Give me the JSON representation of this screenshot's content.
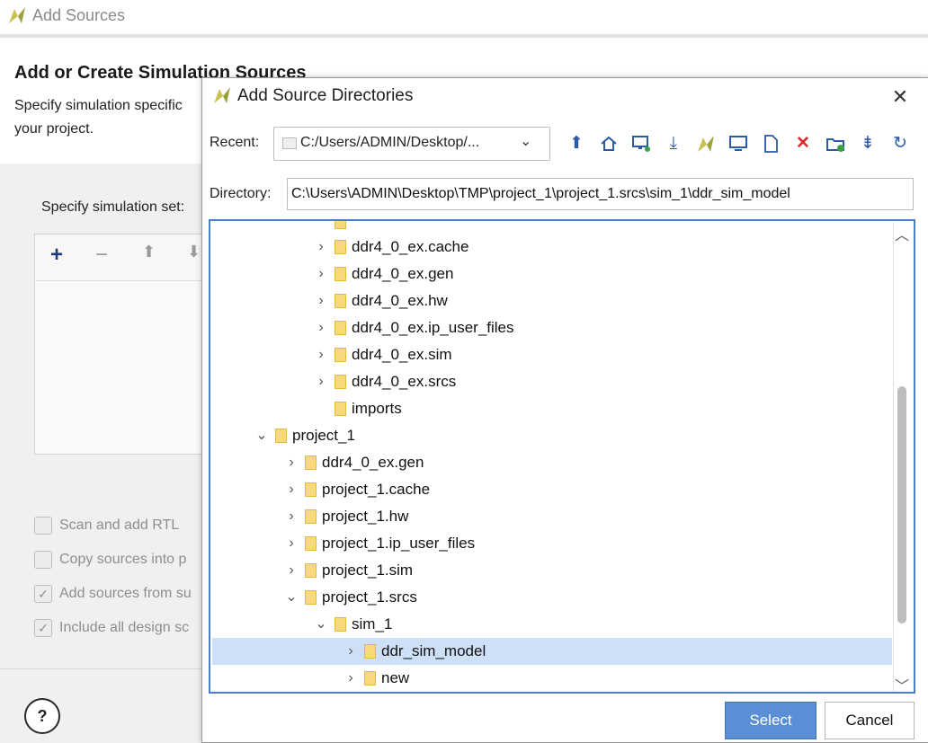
{
  "background": {
    "window_title": "Add Sources",
    "heading": "Add or Create Simulation Sources",
    "description_line1": "Specify simulation specific",
    "description_line2": "your project.",
    "simulation_set_label": "Specify simulation set:",
    "options": [
      {
        "label": "Scan and add RTL",
        "checked": false
      },
      {
        "label": "Copy sources into p",
        "checked": false
      },
      {
        "label": "Add sources from su",
        "checked": true
      },
      {
        "label": "Include all design sc",
        "checked": true
      }
    ],
    "help_label": "?"
  },
  "dialog": {
    "title": "Add Source Directories",
    "close_label": "✕",
    "recent_label": "Recent:",
    "recent_value": "C:/Users/ADMIN/Desktop/...",
    "directory_label": "Directory:",
    "directory_value": "C:\\Users\\ADMIN\\Desktop\\TMP\\project_1\\project_1.srcs\\sim_1\\ddr_sim_model",
    "toolbar_icons": [
      "up-folder-icon",
      "home-icon",
      "network-icon",
      "download-icon",
      "vivado-icon",
      "desktop-icon",
      "file-icon",
      "delete-icon",
      "new-folder-icon",
      "collapse-icon",
      "refresh-icon"
    ],
    "tree": [
      {
        "label": "ddr4_0_ex.cache",
        "depth": 4,
        "expanded": false,
        "has_children": true
      },
      {
        "label": "ddr4_0_ex.gen",
        "depth": 4,
        "expanded": false,
        "has_children": true
      },
      {
        "label": "ddr4_0_ex.hw",
        "depth": 4,
        "expanded": false,
        "has_children": true
      },
      {
        "label": "ddr4_0_ex.ip_user_files",
        "depth": 4,
        "expanded": false,
        "has_children": true
      },
      {
        "label": "ddr4_0_ex.sim",
        "depth": 4,
        "expanded": false,
        "has_children": true
      },
      {
        "label": "ddr4_0_ex.srcs",
        "depth": 4,
        "expanded": false,
        "has_children": true
      },
      {
        "label": "imports",
        "depth": 4,
        "expanded": false,
        "has_children": false
      },
      {
        "label": "project_1",
        "depth": 2,
        "expanded": true,
        "has_children": true
      },
      {
        "label": "ddr4_0_ex.gen",
        "depth": 3,
        "expanded": false,
        "has_children": true
      },
      {
        "label": "project_1.cache",
        "depth": 3,
        "expanded": false,
        "has_children": true
      },
      {
        "label": "project_1.hw",
        "depth": 3,
        "expanded": false,
        "has_children": true
      },
      {
        "label": "project_1.ip_user_files",
        "depth": 3,
        "expanded": false,
        "has_children": true
      },
      {
        "label": "project_1.sim",
        "depth": 3,
        "expanded": false,
        "has_children": true
      },
      {
        "label": "project_1.srcs",
        "depth": 3,
        "expanded": true,
        "has_children": true
      },
      {
        "label": "sim_1",
        "depth": 4,
        "expanded": true,
        "has_children": true
      },
      {
        "label": "ddr_sim_model",
        "depth": 5,
        "expanded": false,
        "has_children": true,
        "selected": true
      },
      {
        "label": "new",
        "depth": 5,
        "expanded": false,
        "has_children": true
      }
    ],
    "select_label": "Select",
    "cancel_label": "Cancel"
  }
}
